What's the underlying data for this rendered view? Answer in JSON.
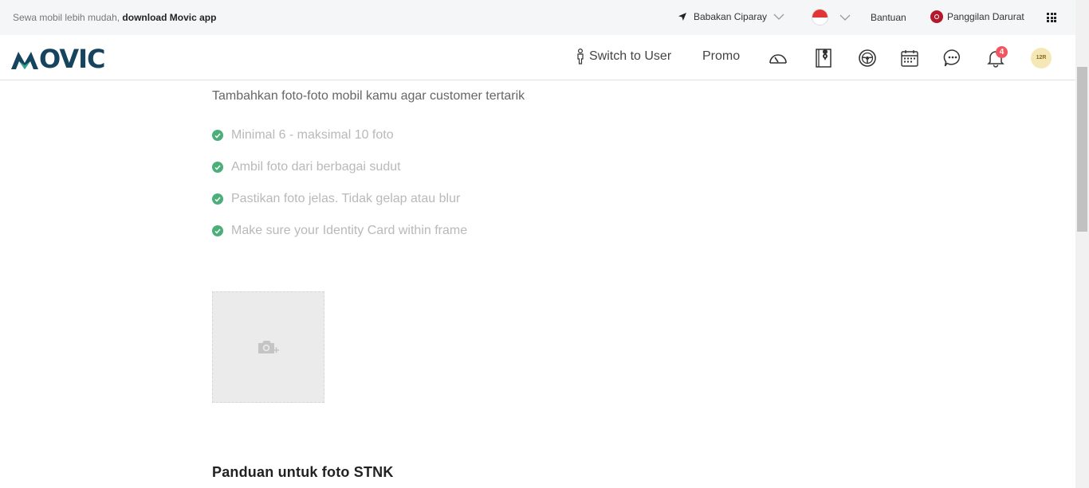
{
  "topbar": {
    "promo_text": "Sewa mobil lebih mudah, ",
    "promo_link": "download Movic app",
    "location": "Babakan Ciparay",
    "help": "Bantuan",
    "emergency": "Panggilan Darurat",
    "icons": [
      "location-arrow-icon",
      "chevron-down-icon",
      "flag-indonesia-icon",
      "emergency-icon",
      "apps-grid-icon"
    ]
  },
  "header": {
    "logo": "MOVIC",
    "switch_label": "Switch to User",
    "promo_label": "Promo",
    "notification_count": "4",
    "avatar_text": "12R",
    "icons": [
      "speedometer-icon",
      "map-book-icon",
      "steering-wheel-icon",
      "calendar-icon",
      "chat-icon",
      "bell-icon"
    ]
  },
  "content": {
    "subtitle": "Tambahkan foto-foto mobil kamu agar customer tertarik",
    "checklist": [
      "Minimal 6 - maksimal 10 foto",
      "Ambil foto dari berbagai sudut",
      "Pastikan foto jelas. Tidak gelap atau blur",
      "Make sure your Identity Card within frame"
    ],
    "upload_icon": "camera-plus-icon",
    "guide_title": "Panduan untuk foto STNK"
  },
  "colors": {
    "brand_dark": "#16445e",
    "brand_green": "#2fa58c",
    "check_green": "#4caf7a",
    "badge_red": "#f2555f",
    "emergency_red": "#b3182b"
  }
}
